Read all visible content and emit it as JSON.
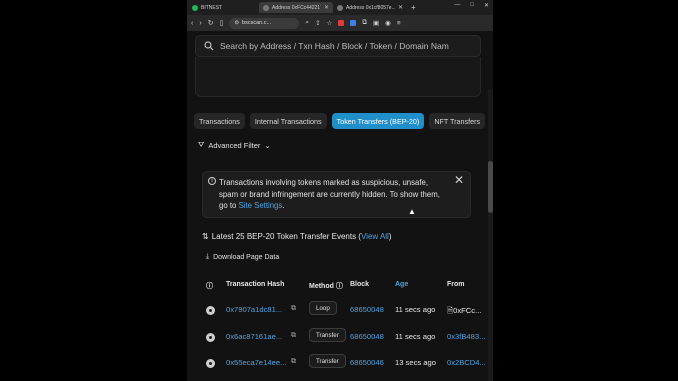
{
  "browser": {
    "app_title": "BITNEST",
    "tabs": [
      {
        "label": "Address 0xFCc442217C...",
        "active": true
      },
      {
        "label": "Address 0x1cf8057e...C9...",
        "active": false
      }
    ],
    "new_tab": "+",
    "url": "bscscan.c...",
    "window_controls": [
      "—",
      "□",
      "✕"
    ]
  },
  "page": {
    "search_placeholder": "Search by Address / Txn Hash / Block / Token / Domain Nam",
    "tabs": [
      {
        "label": "Transactions",
        "active": false
      },
      {
        "label": "Internal Transactions",
        "active": false
      },
      {
        "label": "Token Transfers (BEP-20)",
        "active": true
      },
      {
        "label": "NFT Transfers",
        "active": false
      }
    ],
    "advanced_filter": "Advanced Filter",
    "alert": {
      "text": "Transactions involving tokens marked as suspicious, unsafe, spam or brand infringement are currently hidden. To show them, go to ",
      "link": "Site Settings",
      "end": "."
    },
    "latest": {
      "prefix": "Latest 25 BEP-20 Token Transfer Events (",
      "link": "View All",
      "suffix": ")"
    },
    "download": "Download Page Data",
    "table": {
      "headers": {
        "hash": "Transaction Hash",
        "method": "Method",
        "block": "Block",
        "age": "Age",
        "from": "From"
      },
      "rows": [
        {
          "hash": "0x7907a1dc81...",
          "method": "Loop",
          "block": "68650048",
          "age": "11 secs ago",
          "from": "0xFCc..."
        },
        {
          "hash": "0x6ac87161ae...",
          "method": "Transfer",
          "block": "68650048",
          "age": "11 secs ago",
          "from": "0x3fB483..."
        },
        {
          "hash": "0x55eca7e14ee...",
          "method": "Transfer",
          "block": "68650046",
          "age": "13 secs ago",
          "from": "0x2BCD4..."
        }
      ]
    }
  },
  "colors": {
    "accent": "#1f8fc9",
    "link": "#4fa3e0",
    "background": "#121212"
  }
}
